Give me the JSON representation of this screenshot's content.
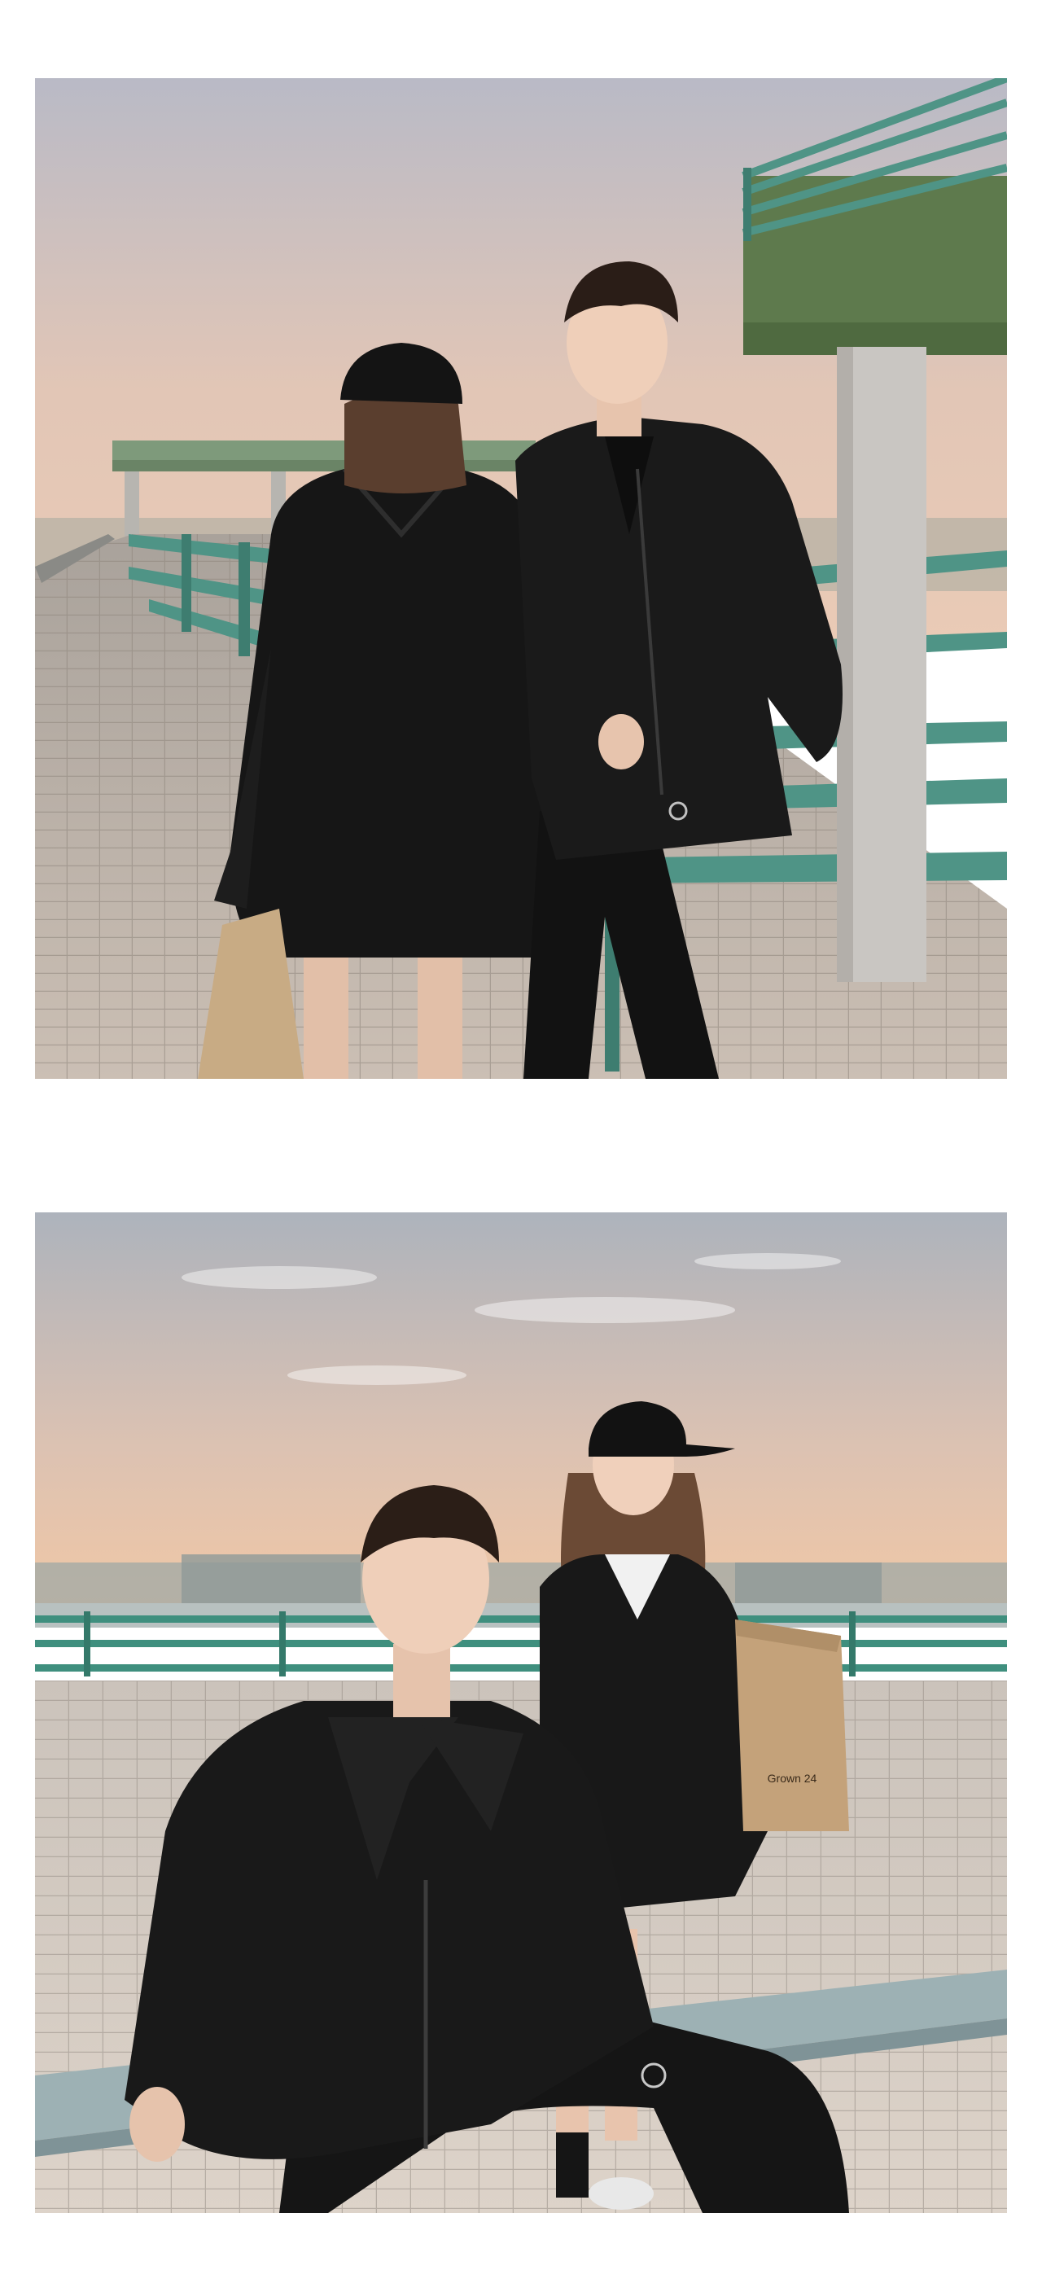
{
  "page": {
    "background": "#ffffff"
  },
  "photos": [
    {
      "scene": "rooftop-walkway",
      "colors": {
        "sky_top": "#b7b9c7",
        "sky_bottom": "#e8c7b2",
        "railing": "#4f9486",
        "structure": "#5e7a4d",
        "column": "#c9c6c2",
        "tiles": "#c8bdb2",
        "jacket": "#161616"
      }
    },
    {
      "scene": "rooftop-sunset",
      "colors": {
        "sky_top": "#aeb3bc",
        "sky_bottom": "#ecc5a8",
        "railing": "#3f8f7e",
        "ledge": "#9db1b4",
        "tiles": "#d8cfc6",
        "jacket": "#151515"
      },
      "bag_text": "Grown 24"
    }
  ]
}
